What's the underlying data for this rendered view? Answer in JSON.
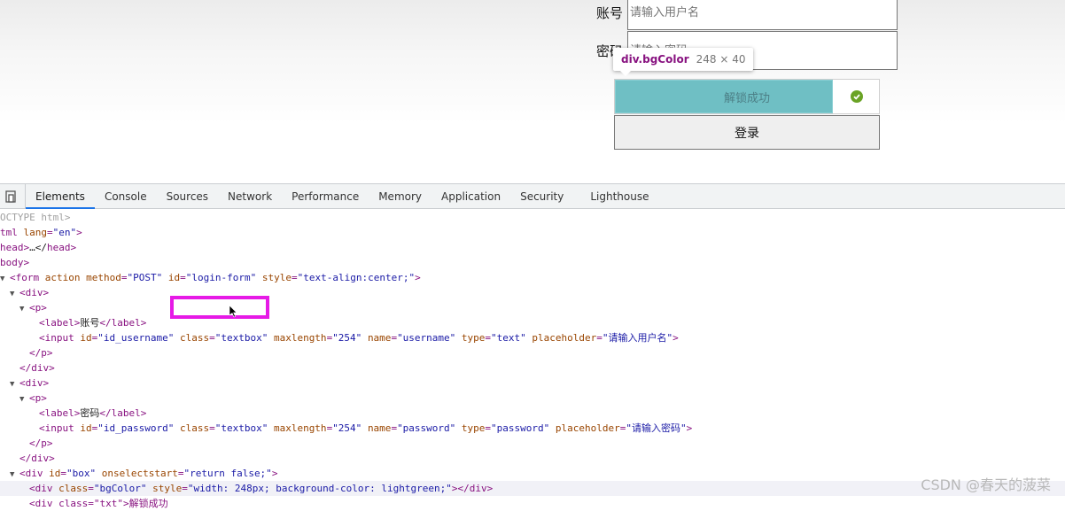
{
  "form": {
    "username_label": "账号",
    "username_placeholder": "请输入用户名",
    "password_label": "密码",
    "password_placeholder": "请输入密码",
    "slider_text": "解锁成功",
    "slider_fill_percent": 82.7,
    "login_label": "登录"
  },
  "tooltip": {
    "name": "div.bgColor",
    "size": "248 × 40"
  },
  "devtools": {
    "tabs": [
      "Elements",
      "Console",
      "Sources",
      "Network",
      "Performance",
      "Memory",
      "Application",
      "Security",
      "Lighthouse"
    ],
    "active_tab": "Elements",
    "lines": {
      "l0": "OCTYPE html>",
      "l1_tag": "tml",
      "l1_attr": "lang",
      "l1_val": "\"en\"",
      "l2_a": "head",
      "l2_b": "…</",
      "l3": "body",
      "l4_tag": "form",
      "l4_a1": "action",
      "l4_a2": "method",
      "l4_v2": "\"POST\"",
      "l4_a3": "id",
      "l4_v3": "\"login-form\"",
      "l4_a4": "style",
      "l4_v4": "\"text-align:center;\"",
      "div": "div",
      "p": "p",
      "label": "label",
      "input": "input",
      "username_label": "账号",
      "password_label": "密码",
      "in_id": "id",
      "in_class": "class",
      "in_max": "maxlength",
      "in_name": "name",
      "in_type": "type",
      "in_ph": "placeholder",
      "u_id": "\"id_username\"",
      "c_textbox": "\"textbox\"",
      "v_254": "\"254\"",
      "u_name": "\"username\"",
      "u_type": "\"text\"",
      "u_ph": "\"请输入用户名\"",
      "p_id": "\"id_password\"",
      "p_name": "\"password\"",
      "p_type": "\"password\"",
      "p_ph": "\"请输入密码\"",
      "box_id": "\"box\"",
      "box_attr": "onselectstart",
      "box_val": "\"return false;\"",
      "bg_class": "\"bgColor\"",
      "bg_style_attr": "style",
      "bg_style_val": "\"width: 248px; background-color: lightgreen;\"",
      "last": "<div class=\"txt\">解锁成功"
    }
  },
  "watermark": "CSDN @春天的菠菜"
}
